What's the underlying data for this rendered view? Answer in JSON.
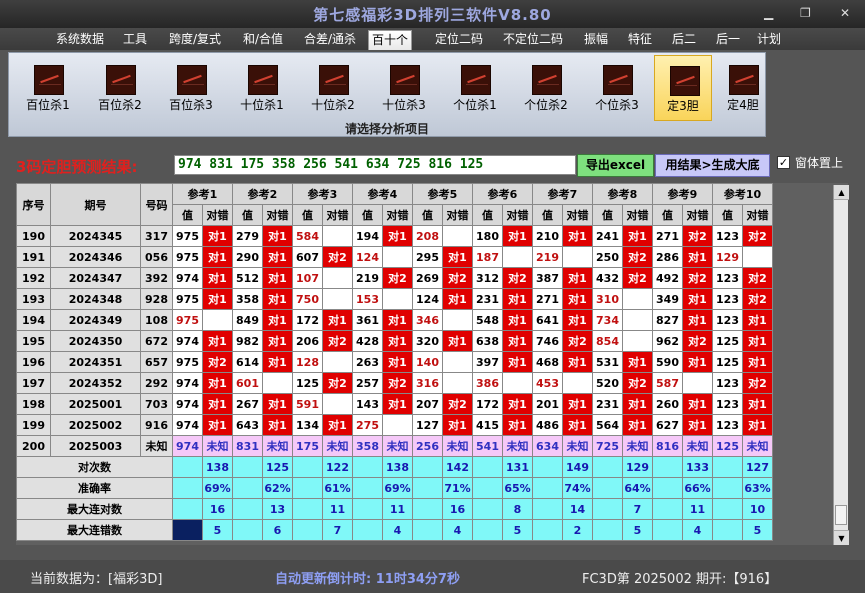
{
  "window": {
    "title": "第七感福彩3D排列三软件V8.80",
    "minimize": "▁",
    "maximize": "❐",
    "close": "✕"
  },
  "menu": [
    "系统数据",
    "工具",
    "跨度/复式",
    "和/合值",
    "合差/通杀",
    "百十个",
    "定位二码",
    "不定位二码",
    "振幅",
    "特征",
    "后二",
    "后一",
    "计划"
  ],
  "menu_active": "百十个",
  "ribbon": {
    "tools": [
      "百位杀1",
      "百位杀2",
      "百位杀3",
      "十位杀1",
      "十位杀2",
      "十位杀3",
      "个位杀1",
      "个位杀2",
      "个位杀3",
      "定3胆",
      "定4胆"
    ],
    "selected": "定3胆",
    "caption": "请选择分析项目"
  },
  "prediction": {
    "label": "3码定胆预测结果:",
    "value": "974 831 175 358 256 541 634 725 816 125",
    "export_button": "导出excel",
    "result_button": "用结果>生成大底",
    "checkbox_label": "窗体置上",
    "checkbox_checked": "✓"
  },
  "table": {
    "headers": [
      "序号",
      "期号",
      "号码"
    ],
    "ref_headers": [
      "参考1",
      "参考2",
      "参考3",
      "参考4",
      "参考5",
      "参考6",
      "参考7",
      "参考8",
      "参考9",
      "参考10"
    ],
    "sub_val": "值",
    "sub_hit": "对错",
    "rows": [
      {
        "seq": "190",
        "period": "2024345",
        "num": "317",
        "refs": [
          [
            "975",
            "对1"
          ],
          [
            "279",
            "对1"
          ],
          [
            "584",
            ""
          ],
          [
            "194",
            "对1"
          ],
          [
            "208",
            ""
          ],
          [
            "180",
            "对1"
          ],
          [
            "210",
            "对1"
          ],
          [
            "241",
            "对1"
          ],
          [
            "271",
            "对2"
          ],
          [
            "123",
            "对2"
          ]
        ]
      },
      {
        "seq": "191",
        "period": "2024346",
        "num": "056",
        "refs": [
          [
            "975",
            "对1"
          ],
          [
            "290",
            "对1"
          ],
          [
            "607",
            "对2"
          ],
          [
            "124",
            ""
          ],
          [
            "295",
            "对1"
          ],
          [
            "187",
            ""
          ],
          [
            "219",
            ""
          ],
          [
            "250",
            "对2"
          ],
          [
            "286",
            "对1"
          ],
          [
            "129",
            ""
          ]
        ]
      },
      {
        "seq": "192",
        "period": "2024347",
        "num": "392",
        "refs": [
          [
            "974",
            "对1"
          ],
          [
            "512",
            "对1"
          ],
          [
            "107",
            ""
          ],
          [
            "219",
            "对2"
          ],
          [
            "269",
            "对2"
          ],
          [
            "312",
            "对2"
          ],
          [
            "387",
            "对1"
          ],
          [
            "432",
            "对2"
          ],
          [
            "492",
            "对2"
          ],
          [
            "123",
            "对2"
          ]
        ]
      },
      {
        "seq": "193",
        "period": "2024348",
        "num": "928",
        "refs": [
          [
            "975",
            "对1"
          ],
          [
            "358",
            "对1"
          ],
          [
            "750",
            ""
          ],
          [
            "153",
            ""
          ],
          [
            "124",
            "对1"
          ],
          [
            "231",
            "对1"
          ],
          [
            "271",
            "对1"
          ],
          [
            "310",
            ""
          ],
          [
            "349",
            "对1"
          ],
          [
            "123",
            "对2"
          ]
        ]
      },
      {
        "seq": "194",
        "period": "2024349",
        "num": "108",
        "refs": [
          [
            "975",
            ""
          ],
          [
            "849",
            "对1"
          ],
          [
            "172",
            "对1"
          ],
          [
            "361",
            "对1"
          ],
          [
            "346",
            ""
          ],
          [
            "548",
            "对1"
          ],
          [
            "641",
            "对1"
          ],
          [
            "734",
            ""
          ],
          [
            "827",
            "对1"
          ],
          [
            "123",
            "对1"
          ]
        ]
      },
      {
        "seq": "195",
        "period": "2024350",
        "num": "672",
        "refs": [
          [
            "974",
            "对1"
          ],
          [
            "982",
            "对1"
          ],
          [
            "206",
            "对2"
          ],
          [
            "428",
            "对1"
          ],
          [
            "320",
            "对1"
          ],
          [
            "638",
            "对1"
          ],
          [
            "746",
            "对2"
          ],
          [
            "854",
            ""
          ],
          [
            "962",
            "对2"
          ],
          [
            "125",
            "对1"
          ]
        ]
      },
      {
        "seq": "196",
        "period": "2024351",
        "num": "657",
        "refs": [
          [
            "975",
            "对2"
          ],
          [
            "614",
            "对1"
          ],
          [
            "128",
            ""
          ],
          [
            "263",
            "对1"
          ],
          [
            "140",
            ""
          ],
          [
            "397",
            "对1"
          ],
          [
            "468",
            "对1"
          ],
          [
            "531",
            "对1"
          ],
          [
            "590",
            "对1"
          ],
          [
            "125",
            "对1"
          ]
        ]
      },
      {
        "seq": "197",
        "period": "2024352",
        "num": "292",
        "refs": [
          [
            "974",
            "对1"
          ],
          [
            "601",
            ""
          ],
          [
            "125",
            "对2"
          ],
          [
            "257",
            "对2"
          ],
          [
            "316",
            ""
          ],
          [
            "386",
            ""
          ],
          [
            "453",
            ""
          ],
          [
            "520",
            "对2"
          ],
          [
            "587",
            ""
          ],
          [
            "123",
            "对2"
          ]
        ]
      },
      {
        "seq": "198",
        "period": "2025001",
        "num": "703",
        "refs": [
          [
            "974",
            "对1"
          ],
          [
            "267",
            "对1"
          ],
          [
            "591",
            ""
          ],
          [
            "143",
            "对1"
          ],
          [
            "207",
            "对2"
          ],
          [
            "172",
            "对1"
          ],
          [
            "201",
            "对1"
          ],
          [
            "231",
            "对1"
          ],
          [
            "260",
            "对1"
          ],
          [
            "123",
            "对1"
          ]
        ]
      },
      {
        "seq": "199",
        "period": "2025002",
        "num": "916",
        "refs": [
          [
            "974",
            "对1"
          ],
          [
            "643",
            "对1"
          ],
          [
            "134",
            "对1"
          ],
          [
            "275",
            ""
          ],
          [
            "127",
            "对1"
          ],
          [
            "415",
            "对1"
          ],
          [
            "486",
            "对1"
          ],
          [
            "564",
            "对1"
          ],
          [
            "627",
            "对1"
          ],
          [
            "123",
            "对1"
          ]
        ]
      }
    ],
    "pred_row": {
      "seq": "200",
      "period": "2025003",
      "num": "未知",
      "refs": [
        [
          "974",
          "未知"
        ],
        [
          "831",
          "未知"
        ],
        [
          "175",
          "未知"
        ],
        [
          "358",
          "未知"
        ],
        [
          "256",
          "未知"
        ],
        [
          "541",
          "未知"
        ],
        [
          "634",
          "未知"
        ],
        [
          "725",
          "未知"
        ],
        [
          "816",
          "未知"
        ],
        [
          "125",
          "未知"
        ]
      ]
    },
    "stats": [
      {
        "label": "对次数",
        "values": [
          "138",
          "125",
          "122",
          "138",
          "142",
          "131",
          "149",
          "129",
          "133",
          "127"
        ]
      },
      {
        "label": "准确率",
        "values": [
          "69%",
          "62%",
          "61%",
          "69%",
          "71%",
          "65%",
          "74%",
          "64%",
          "66%",
          "63%"
        ]
      },
      {
        "label": "最大连对数",
        "values": [
          "16",
          "13",
          "11",
          "11",
          "16",
          "8",
          "14",
          "7",
          "11",
          "10"
        ]
      },
      {
        "label": "最大连错数",
        "values": [
          "5",
          "6",
          "7",
          "4",
          "4",
          "5",
          "2",
          "5",
          "4",
          "5"
        ]
      }
    ]
  },
  "status": {
    "left": "当前数据为：[福彩3D]",
    "mid": "自动更新倒计时:  11时34分7秒",
    "right": "FC3D第 2025002 期开:【916】"
  }
}
